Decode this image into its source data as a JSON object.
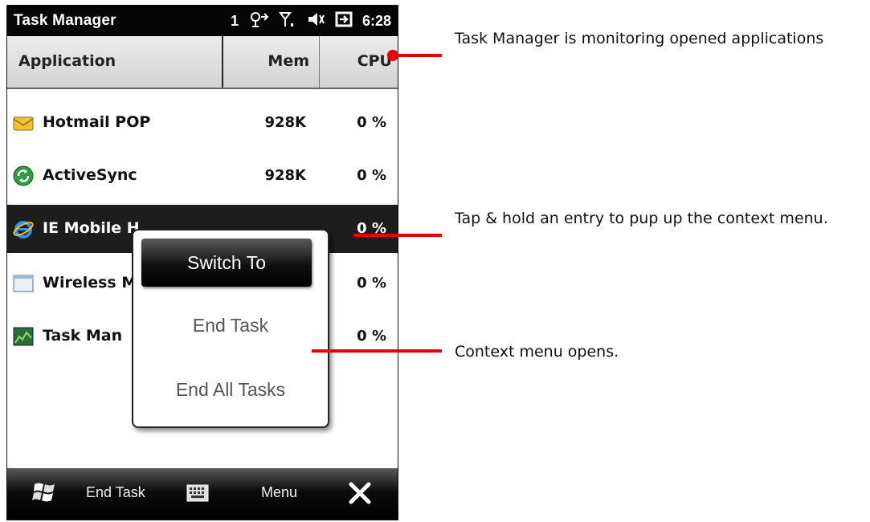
{
  "titlebar": {
    "app_title": "Task Manager",
    "signal_count": "1",
    "time": "6:28",
    "status_icons": [
      "connectivity-icon",
      "signal-bars-icon",
      "speaker-muted-icon",
      "battery-charging-icon"
    ]
  },
  "table": {
    "headers": {
      "application": "Application",
      "mem": "Mem",
      "cpu": "CPU"
    },
    "rows": [
      {
        "name": "Hotmail POP",
        "mem": "928K",
        "cpu": "0 %",
        "icon": "mail-icon"
      },
      {
        "name": "ActiveSync",
        "mem": "928K",
        "cpu": "0 %",
        "icon": "activesync-icon"
      },
      {
        "name": "IE Mobile H",
        "mem": "",
        "cpu": "0 %",
        "icon": "ie-icon",
        "selected": true
      },
      {
        "name": "Wireless M",
        "mem": "",
        "cpu": "0 %",
        "icon": "window-icon"
      },
      {
        "name": "Task Man",
        "mem": "",
        "cpu": "0 %",
        "icon": "task-manager-icon"
      }
    ]
  },
  "context_menu": {
    "items": [
      "Switch To",
      "End Task",
      "End All Tasks"
    ],
    "active_index": 0
  },
  "bottombar": {
    "left_softkey": "End Task",
    "right_softkey": "Menu",
    "icons": [
      "windows-start-icon",
      "keyboard-icon",
      "close-icon"
    ]
  },
  "annotations": [
    "Task Manager is monitoring opened applications",
    "Tap & hold an entry to pup up the context menu.",
    "Context menu opens."
  ],
  "colors": {
    "annotation_red": "#e60000",
    "titlebar": "#050505",
    "selected_row": "#1d1d1d"
  }
}
